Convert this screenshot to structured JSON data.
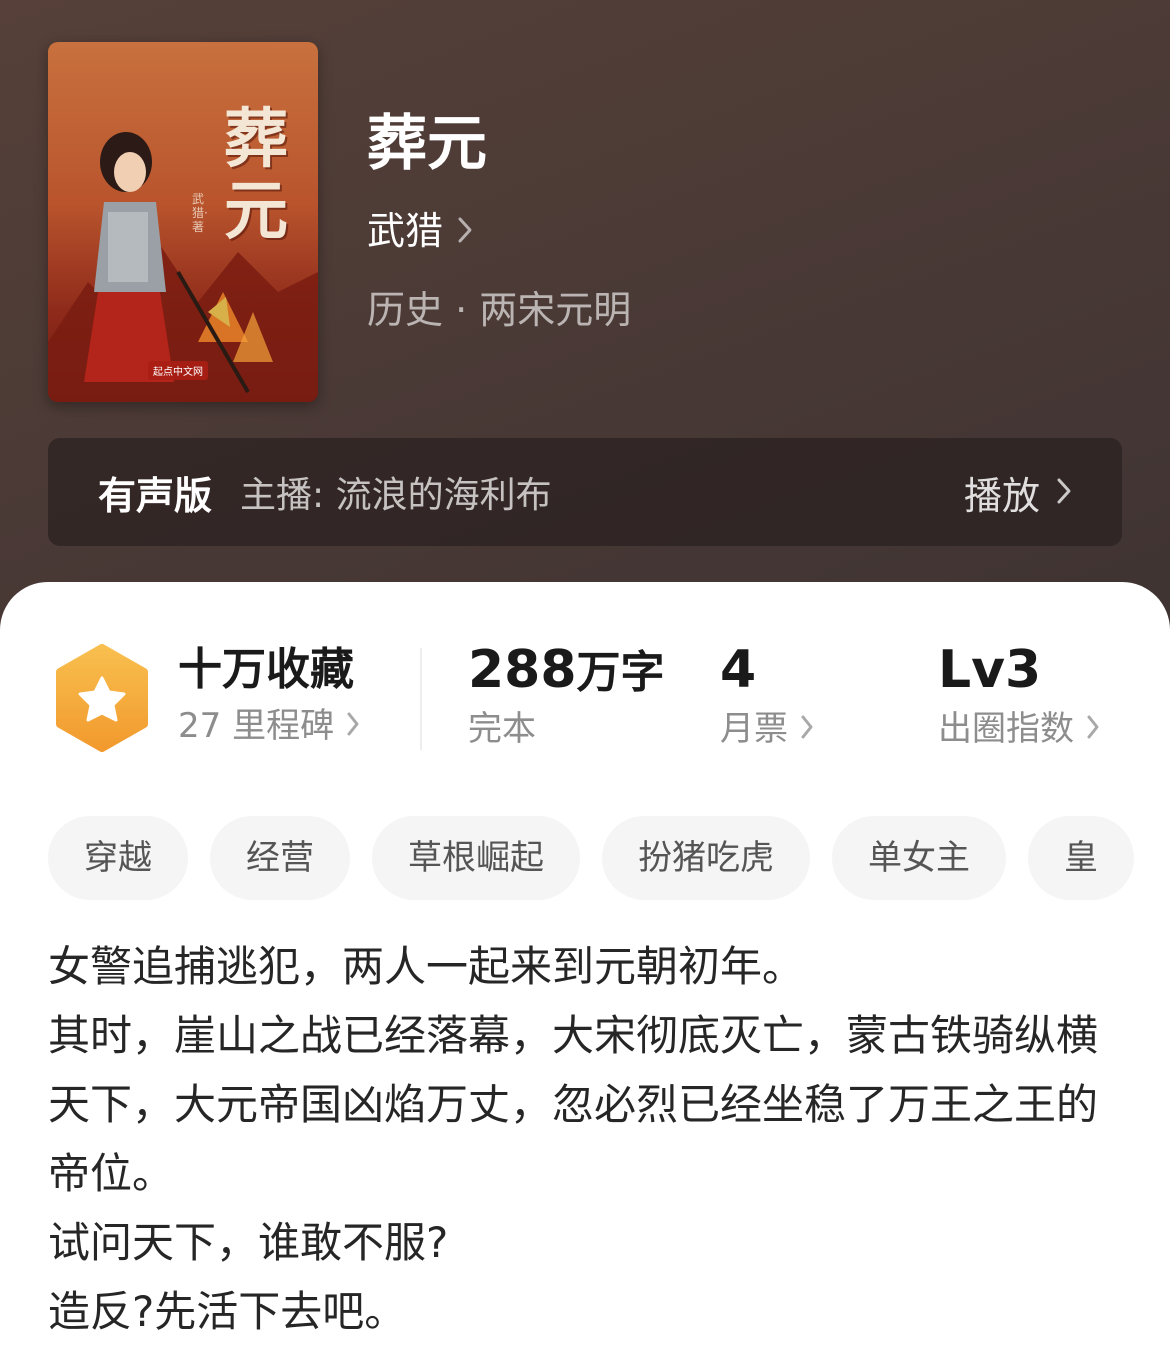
{
  "book": {
    "cover": {
      "title": "葬元",
      "author_mark": "武猎·著",
      "publisher": "起点中文网"
    },
    "title": "葬元",
    "author": "武猎",
    "category": "历史 · 两宋元明"
  },
  "audio": {
    "label": "有声版",
    "host": "主播: 流浪的海利布",
    "play_label": "播放"
  },
  "stats": {
    "collections": {
      "value": "十万收藏",
      "sub": "27 里程碑"
    },
    "words": {
      "number": "288",
      "unit": "万字",
      "sub": "完本"
    },
    "monthly_votes": {
      "value": "4",
      "sub": "月票"
    },
    "circle_index": {
      "value": "Lv3",
      "sub": "出圈指数"
    }
  },
  "tags": [
    "穿越",
    "经营",
    "草根崛起",
    "扮猪吃虎",
    "单女主",
    "皇"
  ],
  "description": [
    "女警追捕逃犯，两人一起来到元朝初年。",
    "其时，崖山之战已经落幕，大宋彻底灭亡，蒙古铁骑纵横天下，大元帝国凶焰万丈，忽必烈已经坐稳了万王之王的帝位。",
    "试问天下，谁敢不服?",
    "造反?先活下去吧。"
  ],
  "colors": {
    "header_bg": "#4b3a36",
    "badge_orange": "#f4a73b",
    "tag_bg": "#f5f5f5"
  },
  "icons": [
    "chevron-right-icon",
    "star-badge-icon"
  ]
}
